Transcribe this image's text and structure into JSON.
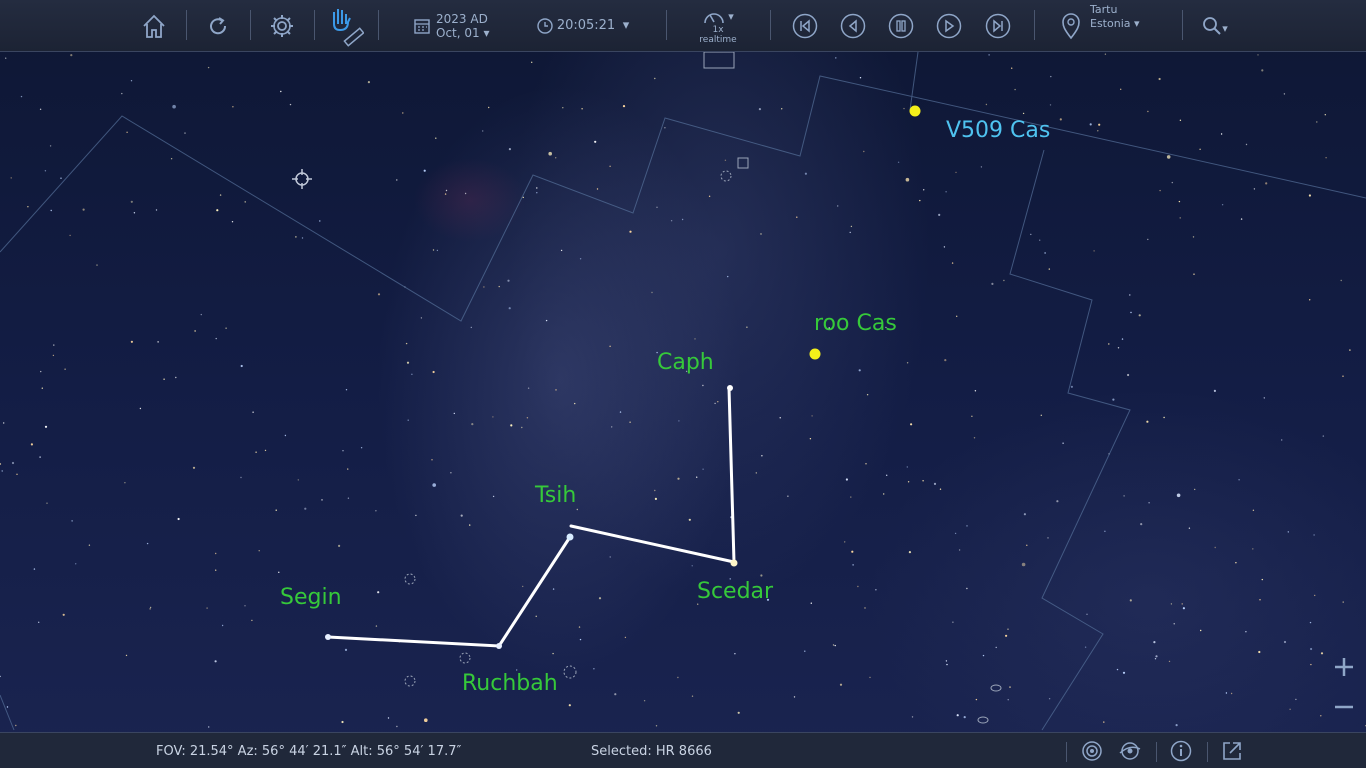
{
  "toolbar": {
    "date_year": "2023 AD",
    "date_day": "Oct, 01 ▾",
    "time": "20:05:21",
    "time_dropdown": "▾",
    "speed_top": "▾",
    "speed_rate": "1x",
    "speed_label": "realtime",
    "location_city": "Tartu",
    "location_country": "Estonia ▾",
    "search_dropdown": "▾",
    "icons": [
      "home-icon",
      "refresh-icon",
      "gear-icon",
      "hand-ruler-icon",
      "calendar-icon",
      "clock-icon",
      "speedometer-icon",
      "skip-back-icon",
      "step-back-icon",
      "pause-icon",
      "play-icon",
      "skip-forward-icon",
      "map-pin-icon",
      "search-icon"
    ]
  },
  "sky": {
    "labels": {
      "v509": "V509 Cas",
      "rho": "roo  Cas",
      "caph": "Caph",
      "tsih": "Tsih",
      "scedar": "Scedar",
      "segin": "Segin",
      "ruchbah": "Ruchbah"
    },
    "colors": {
      "star_label": "#36c93a",
      "variable_label": "#4fc3f0",
      "highlight_star": "#f4f01a",
      "constellation_line": "#ffffff"
    }
  },
  "zoom": {
    "in": "+",
    "out": "−"
  },
  "status": {
    "coords": "FOV: 21.54° Az: 56° 44′ 21.1″ Alt: 56° 54′ 17.7″",
    "selected": "Selected: HR 8666",
    "icons": [
      "target-icon",
      "orbit-icon",
      "info-icon",
      "external-link-icon"
    ]
  }
}
